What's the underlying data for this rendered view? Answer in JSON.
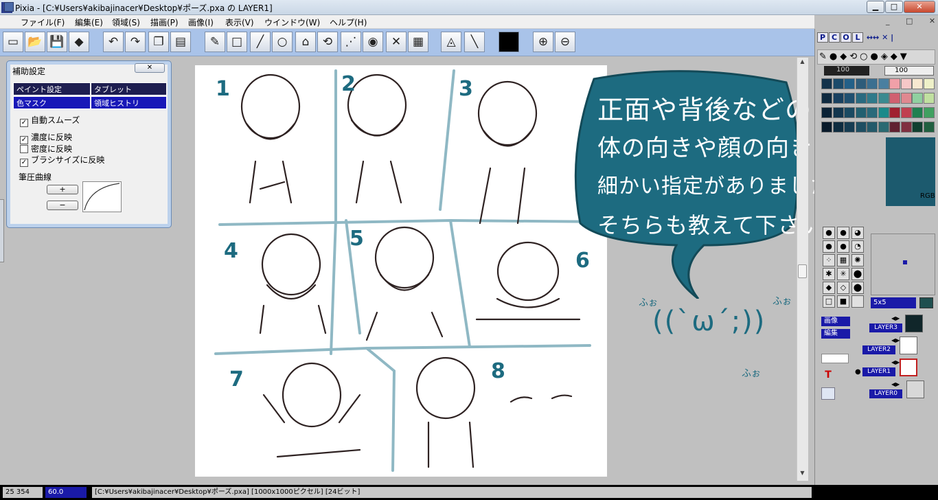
{
  "window": {
    "app_icon_text": "Pi",
    "title": "Pixia - [C:¥Users¥akibajinacer¥Desktop¥ポーズ.pxa の LAYER1]",
    "minimize": "▁",
    "maximize": "□",
    "close": "✕"
  },
  "menu": {
    "items": [
      "ファイル(F)",
      "編集(E)",
      "領域(S)",
      "描画(P)",
      "画像(I)",
      "表示(V)",
      "ウインドウ(W)",
      "ヘルプ(H)"
    ],
    "mdi_buttons": "_ □ ✕"
  },
  "toolbar": {
    "icons": [
      "new-icon",
      "open-icon",
      "save-icon",
      "pen-icon",
      "undo-icon",
      "redo-icon",
      "copy-icon",
      "paste-icon",
      "brush-icon",
      "rect-icon",
      "line-icon",
      "ellipse-icon",
      "polygon-icon",
      "lasso-icon",
      "magic-wand-icon",
      "fill-icon",
      "eraser-icon",
      "checker-icon",
      "bucket-icon",
      "ruler-icon",
      "color-black-icon",
      "zoom-in-icon",
      "zoom-out-icon"
    ],
    "glyphs": [
      "▭",
      "📂",
      "💾",
      "◆",
      "↶",
      "↷",
      "❐",
      "▤",
      "✎",
      "□",
      "╱",
      "○",
      "⌂",
      "⟲",
      "⋰",
      "◉",
      "✕",
      "▦",
      "◬",
      "╲",
      "■",
      "⊕",
      "⊖"
    ]
  },
  "assist_panel": {
    "title": "補助設定",
    "close": "✕",
    "tabs": [
      "ペイント設定",
      "タブレット",
      "色マスク",
      "領域ヒストリ"
    ],
    "smooth": {
      "label": "自動スムーズ",
      "checked": true
    },
    "density": {
      "label": "濃度に反映",
      "checked": true
    },
    "opacity": {
      "label": "密度に反映",
      "checked": false
    },
    "brushsize": {
      "label": "ブラシサイズに反映",
      "checked": true
    },
    "pressure_label": "筆圧曲線",
    "plus": "+",
    "minus": "−"
  },
  "canvas": {
    "pose_numbers": [
      "1",
      "2",
      "3",
      "4",
      "5",
      "6",
      "7",
      "8"
    ],
    "bubble_lines": [
      "正面や背後などの",
      "体の向きや顔の向きに",
      "細かい指定がありましたら",
      "そちらも教えて下さい！"
    ],
    "face": "((`ω´;))",
    "fuwa": [
      "ふぉ",
      "ふぉ",
      "ふぉ"
    ]
  },
  "right_panel": {
    "tabs": [
      "P",
      "C",
      "O",
      "L"
    ],
    "tab_extra": "↔↔ ✕ |",
    "density_value": "100",
    "opacity_value": "100",
    "rgb_label": "RGB",
    "brush_size": "5x5",
    "layer_buttons": [
      "画像",
      "編集"
    ],
    "layers": [
      "LAYER3",
      "LAYER2",
      "LAYER1",
      "LAYER0"
    ],
    "active_layer": "LAYER1"
  },
  "status": {
    "coords": "25 354",
    "zoom": "60.0",
    "path": "[C:¥Users¥akibajinacer¥Desktop¥ポーズ.pxa] [1000x1000ピクセル] [24ビット]"
  },
  "colors": {
    "accent_blue": "#1a1aa8",
    "toolbar": "#a9c3e9",
    "bubble": "#1d6b80"
  }
}
